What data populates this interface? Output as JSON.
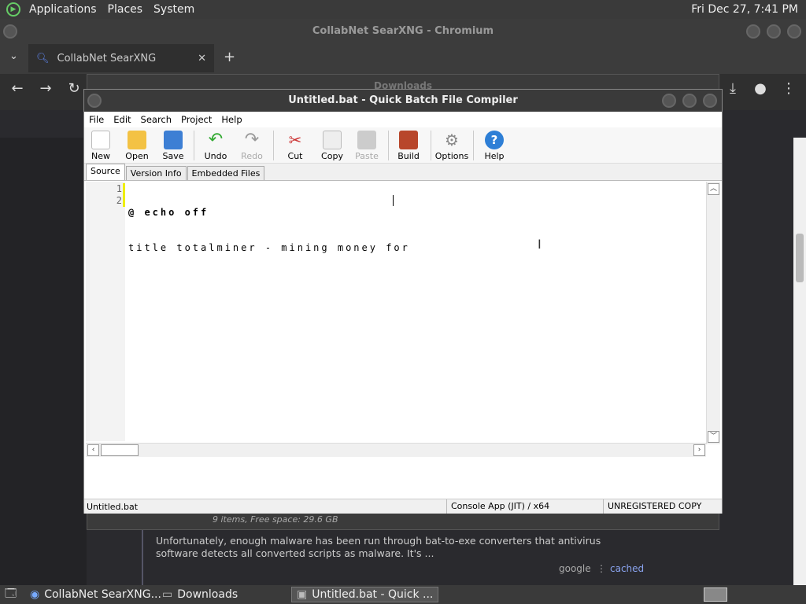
{
  "top_panel": {
    "menus": [
      "Applications",
      "Places",
      "System"
    ],
    "clock": "Fri Dec 27,  7:41 PM"
  },
  "chromium": {
    "window_title": "CollabNet SearXNG - Chromium",
    "tab_title": "CollabNet SearXNG"
  },
  "downloads": {
    "title": "Downloads",
    "status": "9 items, Free space: 29.6 GB"
  },
  "search_result": {
    "snippet": "Unfortunately, enough malware has been run through bat-to-exe converters that antivirus software detects all converted scripts as malware. It's ...",
    "engine": "google",
    "cached": "cached"
  },
  "compiler": {
    "title": "Untitled.bat - Quick Batch File Compiler",
    "menu": [
      "File",
      "Edit",
      "Search",
      "Project",
      "Help"
    ],
    "toolbar": [
      {
        "label": "New",
        "icon": "new-file-icon",
        "enabled": true
      },
      {
        "label": "Open",
        "icon": "folder-open-icon",
        "enabled": true
      },
      {
        "label": "Save",
        "icon": "floppy-icon",
        "enabled": true
      },
      {
        "label": "Undo",
        "icon": "undo-icon",
        "enabled": true
      },
      {
        "label": "Redo",
        "icon": "redo-icon",
        "enabled": false
      },
      {
        "label": "Cut",
        "icon": "scissors-icon",
        "enabled": true
      },
      {
        "label": "Copy",
        "icon": "copy-icon",
        "enabled": true
      },
      {
        "label": "Paste",
        "icon": "paste-icon",
        "enabled": false
      },
      {
        "label": "Build",
        "icon": "build-icon",
        "enabled": true
      },
      {
        "label": "Options",
        "icon": "gear-icon",
        "enabled": true
      },
      {
        "label": "Help",
        "icon": "help-icon",
        "enabled": true
      }
    ],
    "tabs": [
      "Source",
      "Version Info",
      "Embedded Files"
    ],
    "lines": [
      {
        "num": "1",
        "text": "@ echo off"
      },
      {
        "num": "2",
        "text": "title totalminer - mining money for"
      }
    ],
    "status": {
      "file": "Untitled.bat",
      "mode": "Console App (JIT) / x64",
      "license": "UNREGISTERED COPY"
    }
  },
  "taskbar": {
    "items": [
      "CollabNet SearXNG...",
      "Downloads",
      "Untitled.bat - Quick ..."
    ]
  }
}
